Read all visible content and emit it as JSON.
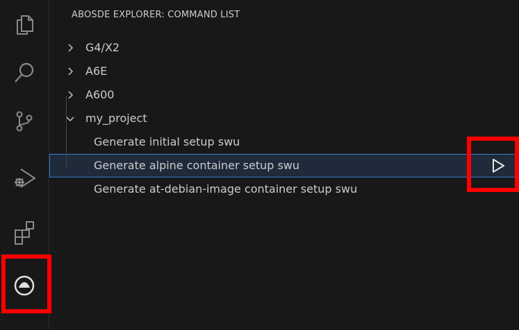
{
  "panel": {
    "title": "ABOSDE EXPLORER: COMMAND LIST"
  },
  "tree": {
    "roots": [
      {
        "label": "G4/X2",
        "expanded": false
      },
      {
        "label": "A6E",
        "expanded": false
      },
      {
        "label": "A600",
        "expanded": false
      },
      {
        "label": "my_project",
        "expanded": true
      }
    ],
    "children": [
      {
        "label": "Generate initial setup swu",
        "selected": false
      },
      {
        "label": "Generate alpine container setup swu",
        "selected": true
      },
      {
        "label": "Generate at-debian-image container setup swu",
        "selected": false
      }
    ]
  },
  "activity_bar": {
    "items": [
      "files-icon",
      "search-icon",
      "source-control-icon",
      "run-debug-icon",
      "extensions-icon",
      "abosde-icon"
    ]
  },
  "colors": {
    "background": "#181818",
    "highlight": "#ff0000",
    "selection_border": "#2f7fd3",
    "text": "#cccccc"
  }
}
